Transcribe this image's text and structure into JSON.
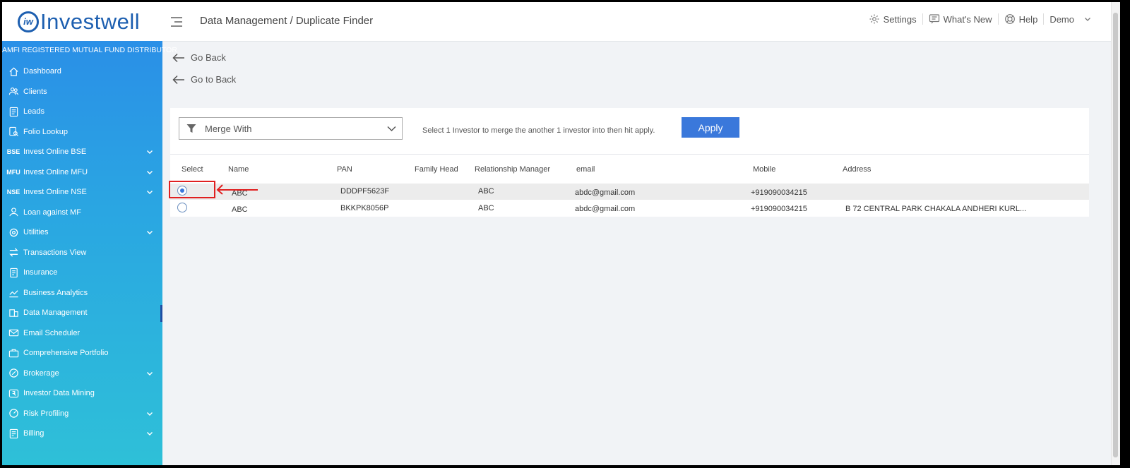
{
  "brand": {
    "logo_mark": "iw",
    "name": "Investwell",
    "tagline": "AMFI REGISTERED MUTUAL FUND DISTRIBUTOR"
  },
  "header": {
    "breadcrumb": "Data Management / Duplicate Finder",
    "settings": "Settings",
    "whats_new": "What's New",
    "help": "Help",
    "user": "Demo"
  },
  "sidebar": {
    "items": [
      {
        "label": "Dashboard",
        "icon": "home-icon"
      },
      {
        "label": "Clients",
        "icon": "users-icon"
      },
      {
        "label": "Leads",
        "icon": "leads-icon"
      },
      {
        "label": "Folio Lookup",
        "icon": "folio-icon"
      },
      {
        "label": "Invest Online BSE",
        "icon": "bse-icon",
        "badge": "BSE"
      },
      {
        "label": "Invest Online MFU",
        "icon": "mfu-icon",
        "badge": "MFU"
      },
      {
        "label": "Invest Online NSE",
        "icon": "nse-icon",
        "badge": "NSE"
      },
      {
        "label": "Loan against MF",
        "icon": "loan-icon"
      },
      {
        "label": "Utilities",
        "icon": "utilities-icon"
      },
      {
        "label": "Transactions View",
        "icon": "transactions-icon"
      },
      {
        "label": "Insurance",
        "icon": "insurance-icon"
      },
      {
        "label": "Business Analytics",
        "icon": "analytics-icon"
      },
      {
        "label": "Data Management",
        "icon": "data-icon"
      },
      {
        "label": "Email Scheduler",
        "icon": "email-icon"
      },
      {
        "label": "Comprehensive Portfolio",
        "icon": "portfolio-icon"
      },
      {
        "label": "Brokerage",
        "icon": "brokerage-icon"
      },
      {
        "label": "Investor Data Mining",
        "icon": "mining-icon"
      },
      {
        "label": "Risk Profiling",
        "icon": "risk-icon"
      },
      {
        "label": "Billing",
        "icon": "billing-icon"
      }
    ]
  },
  "main": {
    "go_back": "Go Back",
    "go_to_back": "Go to Back",
    "merge_select": "Merge With",
    "hint": "Select 1 Investor to merge the another 1 investor into then hit apply.",
    "apply": "Apply"
  },
  "table": {
    "headers": {
      "select": "Select",
      "name": "Name",
      "pan": "PAN",
      "family_head": "Family Head",
      "rm": "Relationship Manager",
      "email": "email",
      "mobile": "Mobile",
      "address": "Address"
    },
    "rows": [
      {
        "selected": true,
        "name": "ABC",
        "pan": "DDDPF5623F",
        "family_head": "",
        "rm": "ABC",
        "email": "abdc@gmail.com",
        "mobile": "+919090034215",
        "address": ""
      },
      {
        "selected": false,
        "name": "ABC",
        "pan": "BKKPK8056P",
        "family_head": "",
        "rm": "ABC",
        "email": "abdc@gmail.com",
        "mobile": "+919090034215",
        "address": "B 72 CENTRAL PARK CHAKALA ANDHERI KURL..."
      }
    ]
  },
  "colors": {
    "accent": "#3a78db",
    "brand": "#1d5fb0",
    "annotation": "#e02020"
  }
}
